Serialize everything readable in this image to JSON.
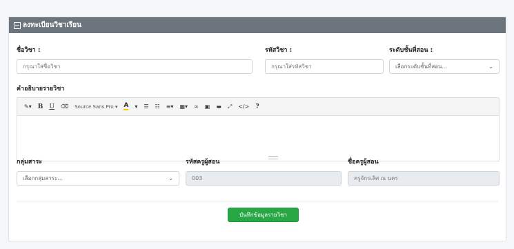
{
  "header": {
    "title": "ลงทะเบียนวิชาเรียน"
  },
  "form": {
    "subject_name": {
      "label": "ชื่อวิชา :",
      "placeholder": "กรุณาใส่ชื่อวิชา",
      "value": ""
    },
    "subject_code": {
      "label": "รหัสวิชา :",
      "placeholder": "กรุณาใส่รหัสวิชา",
      "value": ""
    },
    "grade_level": {
      "label": "ระดับชั้นที่สอน :",
      "selected": "เลือกระดับชั้นที่สอน..."
    },
    "description": {
      "label": "คำอธิบายรายวิชา"
    },
    "subject_group": {
      "label": "กลุ่มสาระ",
      "selected": "เลือกกลุ่มสาระ..."
    },
    "teacher_code": {
      "label": "รหัสครูผู้สอน",
      "value": "003"
    },
    "teacher_name": {
      "label": "ชื่อครูผู้สอน",
      "value": "ครูจักรเลิศ ณ นคร"
    }
  },
  "editor": {
    "toolbar": {
      "magic": "✎▾",
      "bold": "B",
      "underline": "U",
      "eraser": "⌫",
      "font": "Source Sans Pro ▾",
      "color": "A",
      "color_caret": "▾",
      "ul": "☰",
      "ol": "☷",
      "align": "≡▾",
      "table": "▦▾",
      "link": "∞",
      "picture": "▣",
      "video": "▬",
      "fullscreen": "⤢",
      "code": "</>",
      "help": "?"
    }
  },
  "save_button": {
    "label": "บันทึกข้อมูลรายวิชา"
  }
}
